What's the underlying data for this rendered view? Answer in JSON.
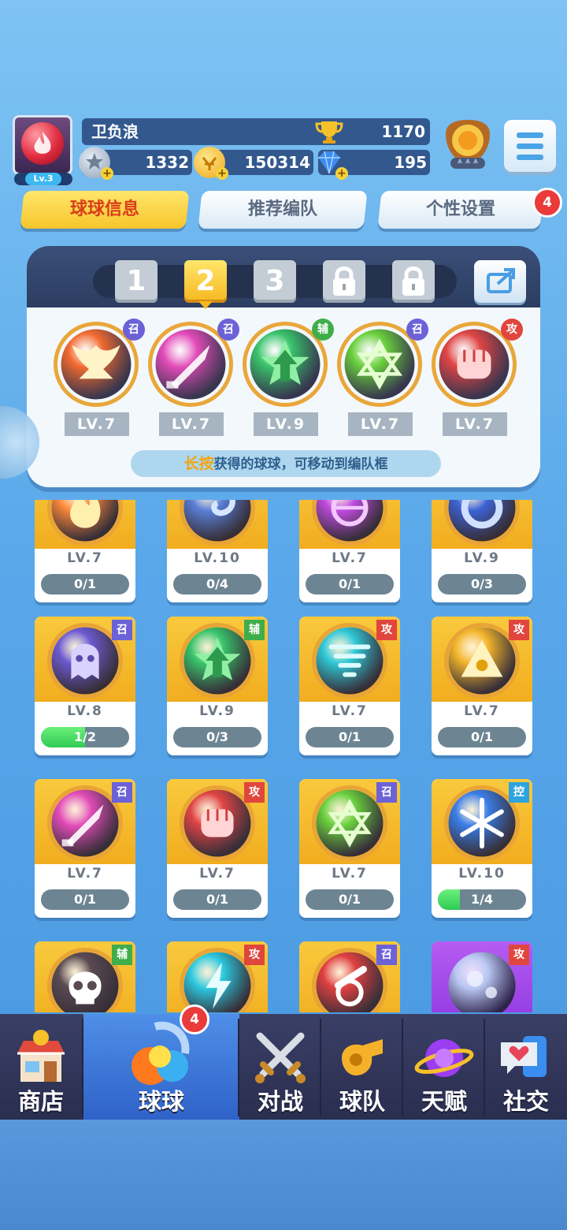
{
  "player": {
    "name": "卫负浪",
    "level": "Lv.3",
    "trophies": "1170"
  },
  "resources": {
    "stars": "1332",
    "coins": "150314",
    "gems": "195"
  },
  "tabs": [
    {
      "label": "球球信息",
      "active": true
    },
    {
      "label": "推荐编队",
      "active": false
    },
    {
      "label": "个性设置",
      "active": false,
      "badge": "4"
    }
  ],
  "lineup": {
    "slots": [
      "1",
      "2",
      "3",
      "locked",
      "locked"
    ],
    "selected_slot": "2",
    "balls": [
      {
        "level": "LV.7",
        "type": "召",
        "color": "#f26a2f",
        "icon": "phoenix-icon"
      },
      {
        "level": "LV.7",
        "type": "召",
        "color": "#e24bb8",
        "icon": "dagger-icon"
      },
      {
        "level": "LV.9",
        "type": "辅",
        "color": "#39c46b",
        "icon": "star-arrow-icon"
      },
      {
        "level": "LV.7",
        "type": "召",
        "color": "#6ad03d",
        "icon": "hexagram-icon"
      },
      {
        "level": "LV.7",
        "type": "攻",
        "color": "#e04545",
        "icon": "fist-icon"
      }
    ],
    "hint_highlight": "长按",
    "hint_text": "获得的球球，可移动到编队框"
  },
  "grid": [
    {
      "level": "LV.7",
      "progress": "0/1",
      "fill": 0,
      "type": "",
      "color": "#ff8a3a",
      "icon": "flame-icon"
    },
    {
      "level": "LV.10",
      "progress": "0/4",
      "fill": 0,
      "type": "",
      "color": "#5a7fd8",
      "icon": "swirl-icon"
    },
    {
      "level": "LV.7",
      "progress": "0/1",
      "fill": 0,
      "type": "",
      "color": "#c04be0",
      "icon": "sphere-icon"
    },
    {
      "level": "LV.9",
      "progress": "0/3",
      "fill": 0,
      "type": "",
      "color": "#3d63d6",
      "icon": "ring-icon"
    },
    {
      "level": "LV.8",
      "progress": "1/2",
      "fill": 0.5,
      "type": "召",
      "color": "#6c5ad0",
      "icon": "ghost-icon"
    },
    {
      "level": "LV.9",
      "progress": "0/3",
      "fill": 0,
      "type": "辅",
      "color": "#39c46b",
      "icon": "star-arrow-icon"
    },
    {
      "level": "LV.7",
      "progress": "0/1",
      "fill": 0,
      "type": "攻",
      "color": "#2fc8d6",
      "icon": "tornado-icon"
    },
    {
      "level": "LV.7",
      "progress": "0/1",
      "fill": 0,
      "type": "攻",
      "color": "#f4b52b",
      "icon": "triangle-icon"
    },
    {
      "level": "LV.7",
      "progress": "0/1",
      "fill": 0,
      "type": "召",
      "color": "#e24bb8",
      "icon": "dagger-icon"
    },
    {
      "level": "LV.7",
      "progress": "0/1",
      "fill": 0,
      "type": "攻",
      "color": "#e04545",
      "icon": "fist-icon"
    },
    {
      "level": "LV.7",
      "progress": "0/1",
      "fill": 0,
      "type": "召",
      "color": "#6ad03d",
      "icon": "hexagram-icon"
    },
    {
      "level": "LV.10",
      "progress": "1/4",
      "fill": 0.25,
      "type": "控",
      "color": "#3a7ee8",
      "icon": "snowflake-icon"
    },
    {
      "level": "",
      "progress": "",
      "fill": 0,
      "type": "辅",
      "color": "#5b4a52",
      "icon": "skull-icon"
    },
    {
      "level": "",
      "progress": "",
      "fill": 0,
      "type": "攻",
      "color": "#2cc9e0",
      "icon": "lightning-icon"
    },
    {
      "level": "",
      "progress": "",
      "fill": 0,
      "type": "召",
      "color": "#e04040",
      "icon": "cannon-icon"
    },
    {
      "level": "",
      "progress": "",
      "fill": 0,
      "type": "攻",
      "color": "#b8c6f2",
      "icon": "bubble-icon",
      "purple": true
    }
  ],
  "type_colors": {
    "召": "#6b62d8",
    "辅": "#3fae4a",
    "攻": "#e0463d",
    "控": "#2ea3e0"
  },
  "nav": {
    "items": [
      {
        "label": "商店",
        "icon": "shop-icon"
      },
      {
        "label": "球球",
        "icon": "balls-icon",
        "badge": "4",
        "active": true
      },
      {
        "label": "对战",
        "icon": "swords-icon"
      },
      {
        "label": "球队",
        "icon": "whistle-icon"
      },
      {
        "label": "天赋",
        "icon": "planet-icon"
      },
      {
        "label": "社交",
        "icon": "chat-heart-icon"
      }
    ]
  }
}
